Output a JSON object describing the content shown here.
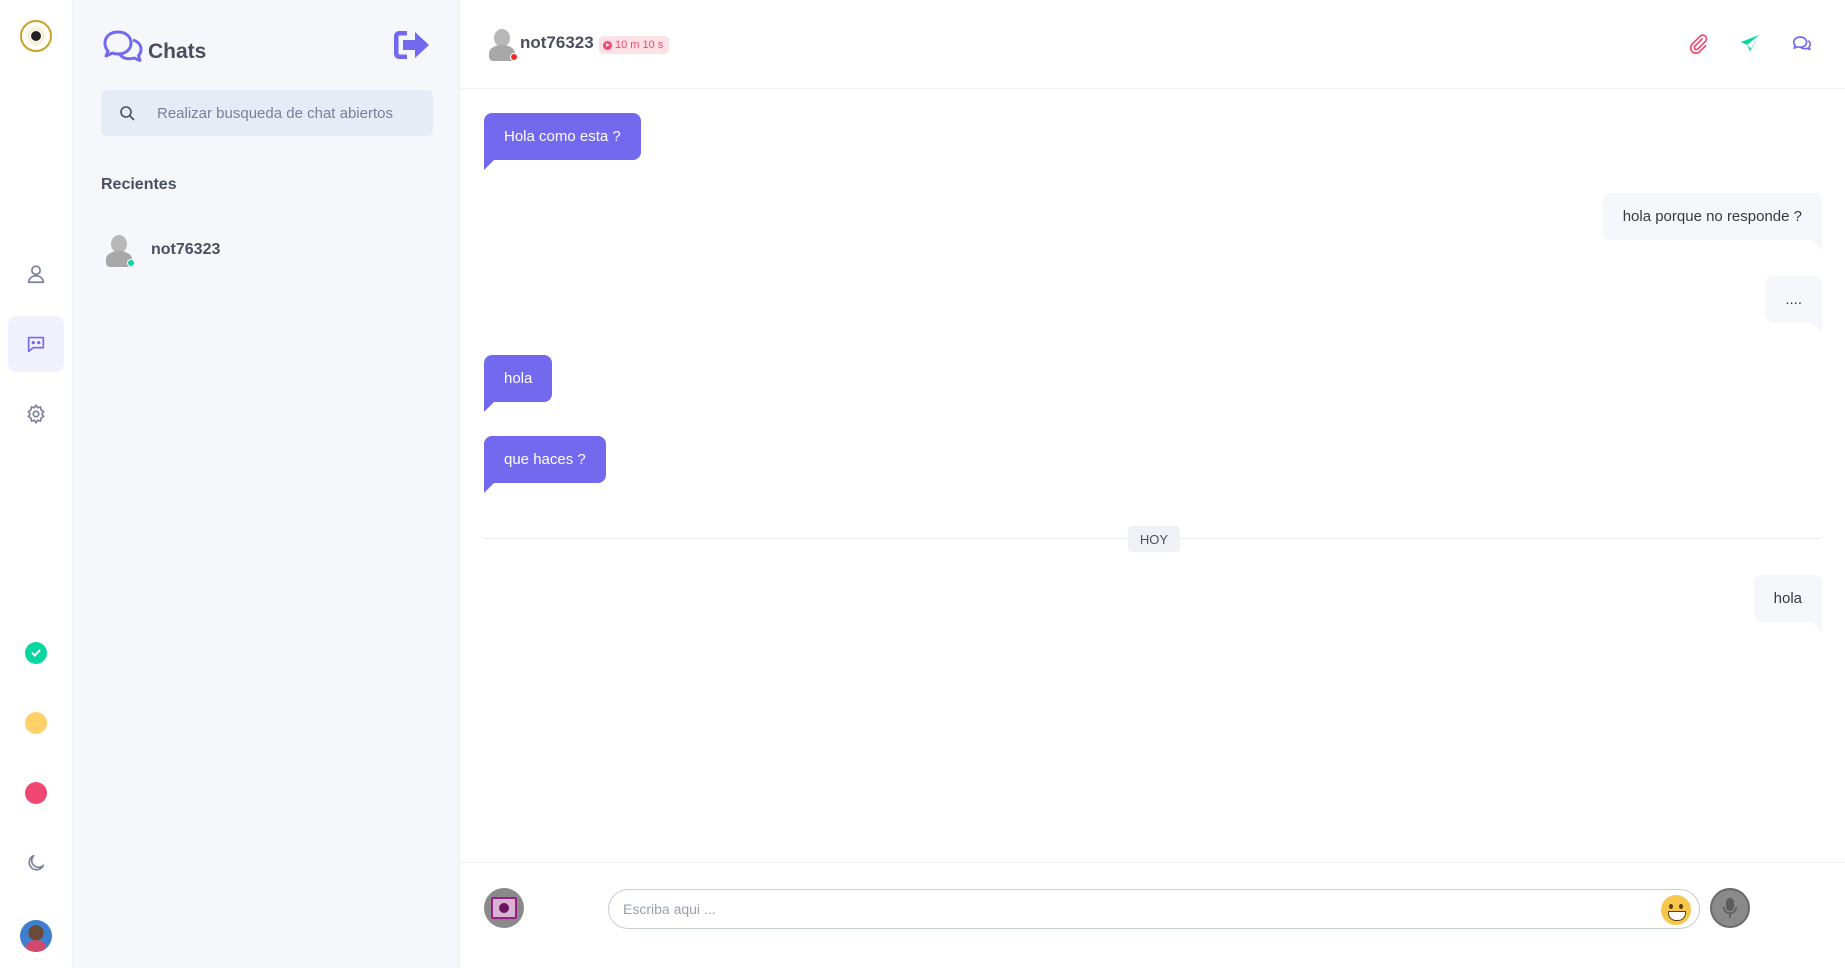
{
  "colors": {
    "accent": "#7269ef",
    "online": "#06d6a0",
    "away": "#ffd166",
    "busy": "#ef476f"
  },
  "rail": {
    "nav": [
      {
        "id": "profile",
        "icon": "user-icon"
      },
      {
        "id": "chats",
        "icon": "chat-icon",
        "active": true
      },
      {
        "id": "settings",
        "icon": "gear-icon"
      }
    ],
    "status": [
      "online",
      "away",
      "busy"
    ],
    "theme_icon": "moon-icon"
  },
  "panel": {
    "title": "Chats",
    "search_placeholder": "Realizar busqueda de chat abiertos",
    "recent_title": "Recientes",
    "recent": [
      {
        "name": "not76323",
        "status": "online"
      }
    ]
  },
  "conversation": {
    "user": {
      "name": "not76323",
      "status": "busy"
    },
    "timer": "10 m 10 s",
    "messages": [
      {
        "dir": "in",
        "text": "Hola como esta ?"
      },
      {
        "dir": "out",
        "text": "hola porque no responde ?"
      },
      {
        "dir": "out",
        "text": "...."
      },
      {
        "dir": "in",
        "text": "hola"
      },
      {
        "dir": "in",
        "text": "que haces ?"
      },
      {
        "dir": "out",
        "text": "hola"
      }
    ],
    "day_separator": "HOY",
    "input_placeholder": "Escriba aqui ..."
  }
}
